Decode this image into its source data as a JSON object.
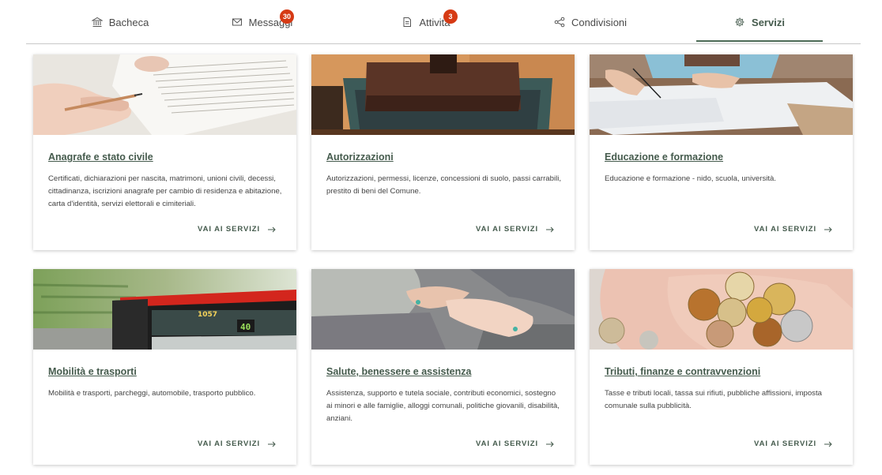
{
  "tabs": [
    {
      "label": "Bacheca",
      "icon": "bank-icon"
    },
    {
      "label": "Messaggi",
      "icon": "envelope-icon",
      "badge": "30"
    },
    {
      "label": "Attività",
      "icon": "document-icon",
      "badge": "3"
    },
    {
      "label": "Condivisioni",
      "icon": "share-icon"
    },
    {
      "label": "Servizi",
      "icon": "gear-icon",
      "active": true
    }
  ],
  "cta_label": "VAI AI SERVIZI",
  "cards": [
    {
      "title": "Anagrafe e stato civile",
      "description": "Certificati, dichiarazioni per nascita, matrimoni, unioni civili, decessi, cittadinanza, iscrizioni anagrafe per cambio di residenza e abitazione, carta d'identità, servizi elettorali e cimiteriali."
    },
    {
      "title": "Autorizzazioni",
      "description": "Autorizzazioni, permessi, licenze, concessioni di suolo, passi carrabili, prestito di beni del Comune."
    },
    {
      "title": "Educazione e formazione",
      "description": "Educazione e formazione - nido, scuola, università."
    },
    {
      "title": "Mobilità e trasporti",
      "description": "Mobilità e trasporti, parcheggi, automobile, trasporto pubblico."
    },
    {
      "title": "Salute, benessere e assistenza",
      "description": "Assistenza, supporto e tutela sociale, contributi economici, sostegno ai minori e alle famiglie, alloggi comunali, politiche giovanili, disabilità, anziani."
    },
    {
      "title": "Tributi, finanze e contravvenzioni",
      "description": "Tasse e tributi locali, tassa sui rifiuti, pubbliche affissioni, imposta comunale sulla pubblicità."
    }
  ],
  "bus": {
    "fleet_number": "1057",
    "route": "40"
  },
  "colors": {
    "accent": "#455b4d",
    "badge": "#d63a14",
    "divider": "#c9c9c9"
  }
}
